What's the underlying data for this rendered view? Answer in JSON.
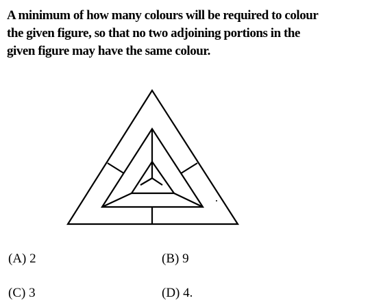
{
  "question": {
    "lines": [
      "A minimum of how many colours will be required to colour",
      "the given figure, so that no two adjoining portions in the",
      "given figure may have the same colour."
    ]
  },
  "options": [
    {
      "label": "(A) 2"
    },
    {
      "label": "(B) 9"
    },
    {
      "label": "(C) 3"
    },
    {
      "label": "(D) 4."
    }
  ]
}
